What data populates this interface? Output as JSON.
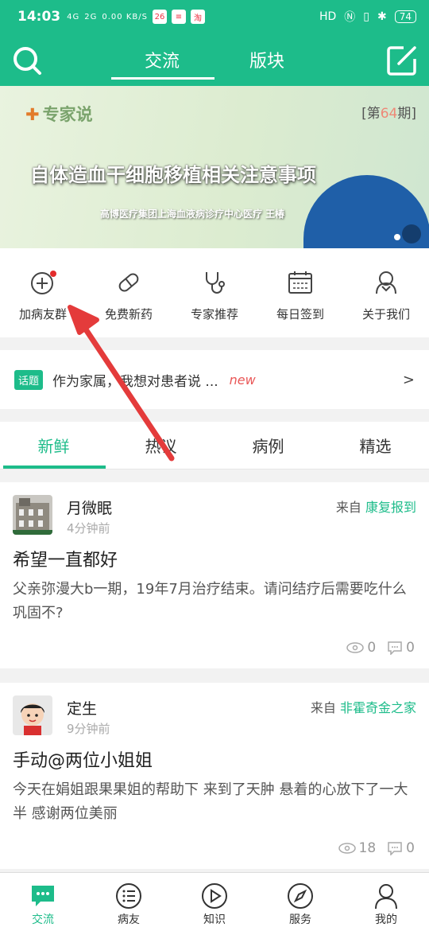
{
  "status_bar": {
    "time": "14:03",
    "signal_1": "4G",
    "signal_2": "2G",
    "net_speed": "0.00 KB/S",
    "right_text": "HD",
    "battery": "74"
  },
  "header": {
    "tabs": [
      {
        "label": "交流",
        "active": true
      },
      {
        "label": "版块",
        "active": false
      }
    ],
    "search_icon": "search-icon",
    "compose_icon": "compose-icon"
  },
  "banner": {
    "brand": "专家说",
    "issue_prefix": "[第",
    "issue_number": "64",
    "issue_suffix": "期]",
    "headline": "自体造血干细胞移植相关注意事项",
    "subtitle": "高博医疗集团上海血液病诊疗中心医疗 王椿"
  },
  "quick_actions": [
    {
      "label": "加病友群",
      "icon": "add-circle-icon",
      "badge": true
    },
    {
      "label": "免费新药",
      "icon": "pill-icon",
      "badge": false
    },
    {
      "label": "专家推荐",
      "icon": "stethoscope-icon",
      "badge": false
    },
    {
      "label": "每日签到",
      "icon": "calendar-icon",
      "badge": false
    },
    {
      "label": "关于我们",
      "icon": "about-us-icon",
      "badge": false
    }
  ],
  "topic": {
    "tag": "话题",
    "text": "作为家属，我想对患者说 ...",
    "new_label": "new",
    "more": ">"
  },
  "feed_tabs": [
    {
      "label": "新鲜",
      "active": true
    },
    {
      "label": "热议",
      "active": false
    },
    {
      "label": "病例",
      "active": false
    },
    {
      "label": "精选",
      "active": false
    }
  ],
  "posts": [
    {
      "author": "月微眠",
      "time": "4分钟前",
      "source_prefix": "来自",
      "source_category": "康复报到",
      "title": "希望一直都好",
      "body": "父亲弥漫大b一期，19年7月治疗结束。请问结疗后需要吃什么巩固不?",
      "views": "0",
      "comments": "0"
    },
    {
      "author": "定生",
      "time": "9分钟前",
      "source_prefix": "来自",
      "source_category": "非霍奇金之家",
      "title": "手动@两位小姐姐",
      "body": "今天在娟姐跟果果姐的帮助下  来到了天肿  悬着的心放下了一大半  感谢两位美丽",
      "views": "18",
      "comments": "0"
    }
  ],
  "bottom_nav": [
    {
      "label": "交流",
      "icon": "chat-bubble-icon",
      "active": true
    },
    {
      "label": "病友",
      "icon": "list-icon",
      "active": false
    },
    {
      "label": "知识",
      "icon": "play-circle-icon",
      "active": false
    },
    {
      "label": "服务",
      "icon": "compass-icon",
      "active": false
    },
    {
      "label": "我的",
      "icon": "profile-icon",
      "active": false
    }
  ],
  "colors": {
    "primary": "#1dbc8a",
    "accent_red": "#e32c2c",
    "new_red": "#e95757"
  }
}
